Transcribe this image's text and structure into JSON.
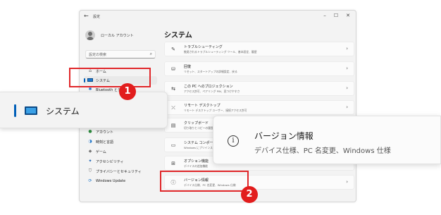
{
  "window": {
    "title": "設定",
    "back_glyph": "←",
    "controls": {
      "minimize": "–",
      "maximize": "☐",
      "close": "✕"
    }
  },
  "account": {
    "name": "ローカル アカウント"
  },
  "search": {
    "placeholder": "設定の検索"
  },
  "sidebar": {
    "items": [
      {
        "label": "ホーム",
        "icon": "home-icon",
        "glyph": "⌂"
      },
      {
        "label": "システム",
        "icon": "system-icon",
        "selected": true
      },
      {
        "label": "Bluetooth とデバイス",
        "icon": "bluetooth-icon",
        "glyph": "✱"
      },
      {
        "label": "アカウント",
        "icon": "account-icon",
        "glyph": "●"
      },
      {
        "label": "時刻と言語",
        "icon": "time-language-icon",
        "glyph": "◑"
      },
      {
        "label": "ゲーム",
        "icon": "game-icon",
        "glyph": "◆"
      },
      {
        "label": "アクセシビリティ",
        "icon": "accessibility-icon",
        "glyph": "✦"
      },
      {
        "label": "プライバシーとセキュリティ",
        "icon": "shield-icon",
        "glyph": "⛉"
      },
      {
        "label": "Windows Update",
        "icon": "windows-update-icon",
        "glyph": "⟳"
      }
    ]
  },
  "main": {
    "title": "システム",
    "cards": [
      {
        "title": "トラブルシューティング",
        "desc": "推奨されるトラブルシューティング ツール、基本設定、履歴",
        "icon": "wrench-icon",
        "glyph": "✎"
      },
      {
        "title": "回復",
        "desc": "リセット、スタートアップの詳細設定、戻る",
        "icon": "recovery-icon",
        "glyph": "⛁"
      },
      {
        "title": "この PC へのプロジェクション",
        "desc": "アクセス許可、ペアリング PIN、見つけやすさ",
        "icon": "projection-icon",
        "glyph": "⇆"
      },
      {
        "title": "リモート デスクトップ",
        "desc": "リモート デスクトップ ユーザー、接続アクセス許可",
        "icon": "remote-desktop-icon",
        "glyph": "⤫"
      },
      {
        "title": "クリップボード",
        "desc": "切り取りとコピーの履歴",
        "icon": "clipboard-icon",
        "glyph": "▤"
      },
      {
        "title": "システム コンポーネント",
        "desc": "Windows にプリインストール",
        "icon": "components-icon",
        "glyph": "▭"
      },
      {
        "title": "オプション機能",
        "desc": "デバイスの追加機能",
        "icon": "optional-features-icon",
        "glyph": "⊞"
      },
      {
        "title": "バージョン情報",
        "desc": "デバイス仕様、PC 名変更、Windows 仕様",
        "icon": "info-icon",
        "glyph": "ⓘ"
      }
    ],
    "chevron": "›"
  },
  "zoom": {
    "nav_label": "システム",
    "card_title": "バージョン情報",
    "card_desc": "デバイス仕様、PC 名変更、Windows 仕様",
    "info_glyph": "i"
  },
  "callouts": {
    "step1": "1",
    "step2": "2"
  },
  "colors": {
    "accent": "#005fb8",
    "highlight": "#e0272a",
    "badge": "#e21d1d"
  }
}
